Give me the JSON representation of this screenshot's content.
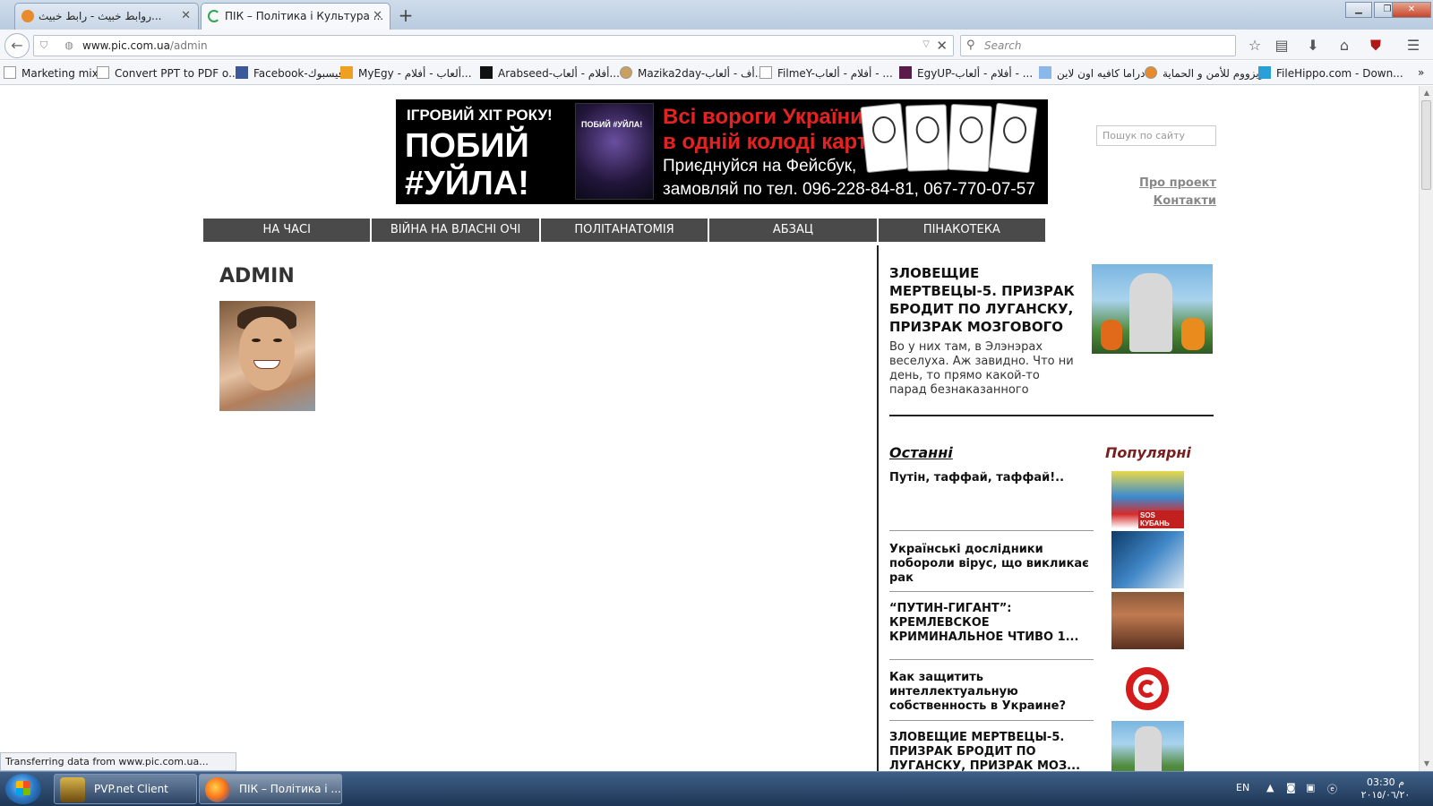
{
  "browser": {
    "tabs": [
      {
        "label": "روابط خبيث - رابط خبيث...",
        "active": false
      },
      {
        "label": "ПІК – Політика і Культура ...",
        "active": true
      }
    ],
    "new_tab": "+",
    "url_host": "www.pic.com.ua",
    "url_path": "/admin",
    "search_placeholder": "Search",
    "bookmarks": [
      "Marketing mix",
      "Convert PPT to PDF o...",
      "Facebook-فيسبوك",
      "MyEgy - ألعاب - أفلام...",
      "Arabseed-أفلام - ألعاب...",
      "Mazika2day-أف - ألعاب...",
      "FilmeY-أفلام - ألعاب - ...",
      "EgyUP-أفلام - ألعاب - ...",
      "دراما كافيه اون لاين",
      "زيزووم للأمن و الحماية",
      "FileHippo.com - Down..."
    ],
    "bookmarks_overflow": "»",
    "status_text": "Transferring data from www.pic.com.ua..."
  },
  "banner": {
    "line1": "ІГРОВИЙ ХІТ РОКУ!",
    "line2": "ПОБИЙ",
    "line3": "#УЙЛА!",
    "art_label": "ПОБИЙ #УЙЛА!",
    "red1": "Всі вороги України",
    "red2": "в одній колоді карт!",
    "white1": "Приєднуйся на Фейсбук,",
    "white2": "замовляй по тел. 096-228-84-81, 067-770-07-57"
  },
  "site": {
    "search_placeholder": "Пошук по сайту",
    "top_links": [
      "Про проект",
      "Контакти"
    ],
    "menu": [
      "НА ЧАСІ",
      "ВІЙНА НА ВЛАСНІ ОЧІ",
      "ПОЛІТАНАТОМІЯ",
      "АБЗАЦ",
      "ПІНАКОТЕКА"
    ]
  },
  "main": {
    "title": "ADMIN"
  },
  "sidebar": {
    "featured": {
      "title": "ЗЛОВЕЩИЕ МЕРТВЕЦЫ-5. ПРИЗРАК БРОДИТ ПО ЛУГАНСКУ, ПРИЗРАК МОЗГОВОГО",
      "excerpt": "Во у них там, в Элэнэрах веселуха. Аж завидно. Что ни день, то прямо какой-то парад безнаказанного"
    },
    "tab_latest": "Останні",
    "tab_popular": "Популярні",
    "popular": [
      "Путін, таффай, таффай!..",
      "Українські дослідники побороли вірус, що викликає рак",
      "“ПУТИН-ГИГАНТ”: КРЕМЛЕВСКОЕ КРИМИНАЛЬНОЕ ЧТИВО 1...",
      "Как защитить интеллектуальную собственность в Украине?",
      "ЗЛОВЕЩИЕ МЕРТВЕЦЫ-5. ПРИЗРАК БРОДИТ ПО ЛУГАНСКУ, ПРИЗРАК МОЗ..."
    ],
    "thumb_1_label": "SOS КУБАНЬ"
  },
  "taskbar": {
    "tasks": [
      "PVP.net Client",
      "ПІК – Політика і ..."
    ],
    "lang": "EN",
    "time": "03:30 م",
    "date": "٢٠١٥/٠٦/٢٠"
  }
}
